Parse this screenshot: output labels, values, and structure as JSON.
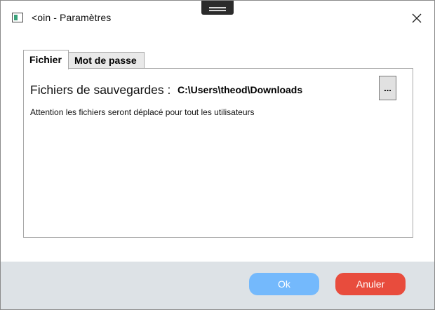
{
  "window": {
    "title": "<oin - Paramètres",
    "app_icon": "window-app-icon",
    "close_icon": "close-icon"
  },
  "tabs": [
    {
      "label": "Fichier",
      "active": true
    },
    {
      "label": "Mot de passe",
      "active": false
    }
  ],
  "fichier": {
    "backup_label": "Fichiers de sauvegardes :",
    "backup_path": "C:\\Users\\theod\\Downloads",
    "browse_label": "...",
    "notice": "Attention les fichiers seront déplacé pour tout les utilisateurs"
  },
  "footer": {
    "ok_label": "Ok",
    "cancel_label": "Anuler"
  },
  "colors": {
    "ok_button": "#74b9fc",
    "cancel_button": "#e84c3d",
    "footer_bg": "#dde2e6"
  }
}
